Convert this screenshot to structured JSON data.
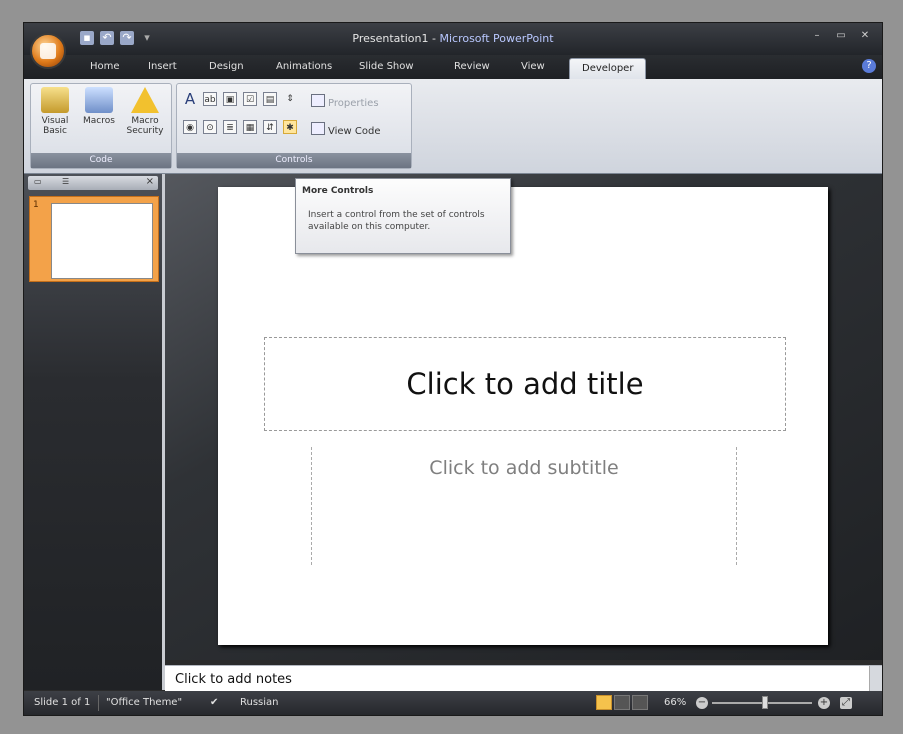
{
  "window": {
    "title_doc": "Presentation1",
    "title_sep": " - ",
    "title_app": "Microsoft PowerPoint"
  },
  "tabs": [
    "Home",
    "Insert",
    "Design",
    "Animations",
    "Slide Show",
    "Review",
    "View",
    "Developer"
  ],
  "active_tab": "Developer",
  "ribbon": {
    "code_group": {
      "label": "Code",
      "visual_basic": "Visual Basic",
      "macros": "Macros",
      "macro_security": "Macro Security"
    },
    "controls_group": {
      "label": "Controls",
      "properties": "Properties",
      "view_code": "View Code"
    }
  },
  "tooltip": {
    "title": "More Controls",
    "body": "Insert a control from the set of controls available on this computer."
  },
  "slide_pane": {
    "thumb_number": "1"
  },
  "slide": {
    "title_placeholder": "Click to add title",
    "subtitle_placeholder": "Click to add subtitle"
  },
  "notes": {
    "placeholder": "Click to add notes"
  },
  "status": {
    "slide_info": "Slide 1 of 1",
    "theme": "\"Office Theme\"",
    "language": "Russian",
    "zoom": "66%"
  },
  "colors": {
    "accent_orange": "#f3a249",
    "ribbon_bg": "#dfe3ea",
    "frame_dark": "#2b2b2b"
  }
}
